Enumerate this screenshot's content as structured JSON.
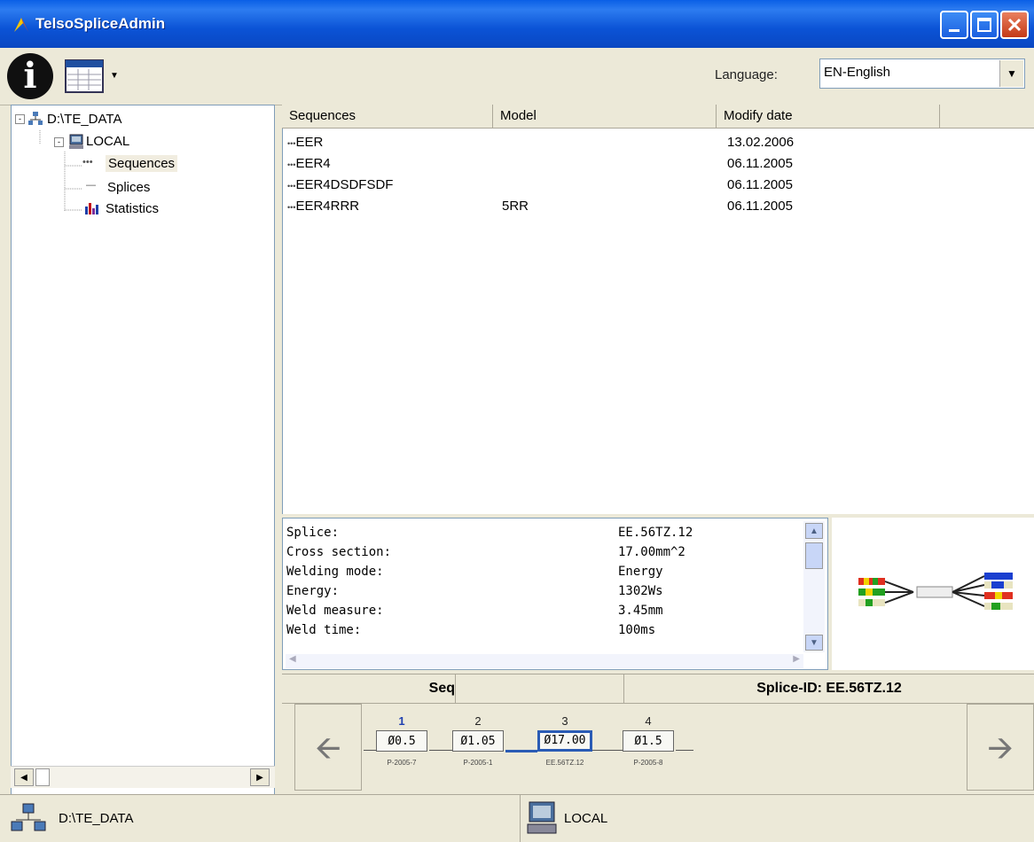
{
  "window": {
    "title": "TelsoSpliceAdmin"
  },
  "toolbar": {
    "language_label": "Language:",
    "language_value": "EN-English"
  },
  "tree": {
    "root": "D:\\TE_DATA",
    "child": "LOCAL",
    "items": [
      {
        "label": "Sequences",
        "selected": true
      },
      {
        "label": "Splices",
        "selected": false
      },
      {
        "label": "Statistics",
        "selected": false
      }
    ]
  },
  "list": {
    "columns": [
      "Sequences",
      "Model",
      "Modify date"
    ],
    "rows": [
      {
        "name": "EER",
        "model": "",
        "date": "13.02.2006"
      },
      {
        "name": "EER4",
        "model": "",
        "date": "06.11.2005"
      },
      {
        "name": "EER4DSDFSDF",
        "model": "",
        "date": "06.11.2005"
      },
      {
        "name": "EER4RRR",
        "model": "5RR",
        "date": "06.11.2005"
      }
    ]
  },
  "details": {
    "rows": [
      {
        "label": "Splice:",
        "value": "EE.56TZ.12"
      },
      {
        "label": "Cross section:",
        "value": "17.00mm^2"
      },
      {
        "label": "Welding mode:",
        "value": "Energy"
      },
      {
        "label": "Energy:",
        "value": "1302Ws"
      },
      {
        "label": "Weld measure:",
        "value": "3.45mm"
      },
      {
        "label": "Weld time:",
        "value": "100ms"
      }
    ]
  },
  "seqbar": {
    "seq_label": "Seq",
    "splice_id": "Splice-ID: EE.56TZ.12"
  },
  "steps": [
    {
      "num": "1",
      "value": "Ø0.5",
      "sub": "P-2005-7",
      "active": false
    },
    {
      "num": "2",
      "value": "Ø1.05",
      "sub": "P-2005-1",
      "active": false
    },
    {
      "num": "3",
      "value": "Ø17.00",
      "sub": "EE.56TZ.12",
      "active": true
    },
    {
      "num": "4",
      "value": "Ø1.5",
      "sub": "P-2005-8",
      "active": false
    }
  ],
  "status": {
    "left": "D:\\TE_DATA",
    "right": "LOCAL"
  },
  "colors": {
    "titlebar": "#0a5fe6",
    "accent": "#2a5bb5",
    "panel": "#ece9d8"
  }
}
